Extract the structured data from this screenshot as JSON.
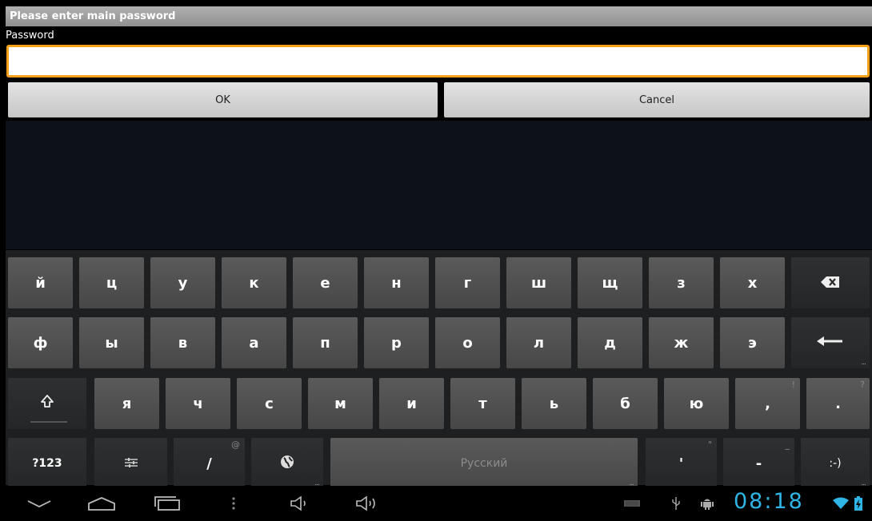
{
  "dialog": {
    "title": "Please enter main password",
    "password_label": "Password",
    "password_value": "",
    "ok_label": "OK",
    "cancel_label": "Cancel",
    "accent_color": "#f4a018"
  },
  "keyboard": {
    "row1": [
      "й",
      "ц",
      "у",
      "к",
      "е",
      "н",
      "г",
      "ш",
      "щ",
      "з",
      "х"
    ],
    "row2": [
      "ф",
      "ы",
      "в",
      "а",
      "п",
      "р",
      "о",
      "л",
      "д",
      "ж",
      "э"
    ],
    "row3": [
      "я",
      "ч",
      "с",
      "м",
      "и",
      "т",
      "ь",
      "б",
      "ю",
      ",",
      "."
    ],
    "row3_hints": {
      "comma": "!",
      "period": "?"
    },
    "symbols_label": "?123",
    "slash_label": "/",
    "slash_hint": "@",
    "space_label": "Русский",
    "apostrophe_label": "'",
    "apostrophe_hint": "\"",
    "dash_label": "-",
    "dash_hint": "_",
    "smiley_label": ":-)",
    "icons": {
      "backspace": "backspace-icon",
      "enter": "enter-icon",
      "shift": "shift-icon",
      "settings": "settings-sliders-icon",
      "language": "globe-icon"
    }
  },
  "status_bar": {
    "time": "08:18",
    "time_color": "#2fb5e5"
  }
}
